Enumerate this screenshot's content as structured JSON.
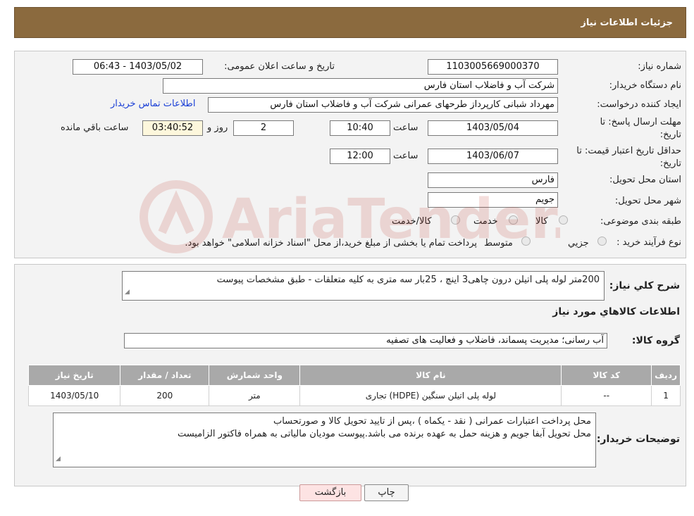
{
  "header": {
    "title": "جزئیات اطلاعات نیاز"
  },
  "fields": {
    "need_number_label": "شماره نیاز:",
    "need_number": "1103005669000370",
    "announce_label": "تاریخ و ساعت اعلان عمومی:",
    "announce_value": "1403/05/02 - 06:43",
    "buyer_org_label": "نام دستگاه خریدار:",
    "buyer_org": "شرکت آب و فاضلاب استان فارس",
    "creator_label": "ایجاد کننده درخواست:",
    "creator": "مهرداد شبانی کارپرداز طرحهای عمرانی  شرکت آب و فاضلاب استان فارس",
    "contact_link": "اطلاعات تماس خریدار",
    "deadline_label_1": "مهلت ارسال پاسخ: تا",
    "deadline_label_2": "تاریخ:",
    "deadline_date": "1403/05/04",
    "time_label": "ساعت",
    "deadline_time": "10:40",
    "days_value": "2",
    "days_label": "روز و",
    "remaining_time": "03:40:52",
    "remaining_label": "ساعت باقي مانده",
    "validity_label_1": "حداقل تاریخ اعتبار قیمت: تا",
    "validity_label_2": "تاریخ:",
    "validity_date": "1403/06/07",
    "validity_time_label": "ساعت",
    "validity_time": "12:00",
    "province_label": "استان محل تحویل:",
    "province": "فارس",
    "city_label": "شهر محل تحویل:",
    "city": "جویم",
    "category_label": "طبقه بندی موضوعی:",
    "category_options": [
      "کالا",
      "خدمت",
      "کالا/خدمت"
    ],
    "process_label": "نوع فرآیند خرید :",
    "process_options": [
      "جزیي",
      "متوسط"
    ],
    "process_note": "پرداخت تمام یا بخشی از مبلغ خرید،از محل \"اسناد خزانه اسلامی\" خواهد بود."
  },
  "description": {
    "label": "شرح كلي نياز:",
    "value": "200متر لوله پلی اتیلن درون چاهی3 اینچ ، 25بار سه متری به کلیه متعلقات - طبق مشخصات پیوست"
  },
  "goods_section_title": "اطلاعات كالاهاي مورد نياز",
  "goods_group": {
    "label": "گروه كالا:",
    "value": "آب رسانی؛ مدیریت پسماند، فاضلاب و فعالیت های تصفیه"
  },
  "table": {
    "headers": [
      "ردیف",
      "کد کالا",
      "نام کالا",
      "واحد شمارش",
      "تعداد / مقدار",
      "تاریخ نیاز"
    ],
    "rows": [
      [
        "1",
        "--",
        "لوله پلی اتیلن سنگین (HDPE) تجاری",
        "متر",
        "200",
        "1403/05/10"
      ]
    ]
  },
  "buyer_notes": {
    "label": "توضیحات خریدار:",
    "line1": "محل پرداخت اعتبارات عمرانی ( نقد - یکماه )    ،پس از تایید تحویل کالا و صورتحساب",
    "line2": "محل تحویل  آبفا جویم  و هزینه حمل به عهده برنده می باشد.پیوست مودیان مالیاتی به همراه فاکتور الزامیست"
  },
  "buttons": {
    "print": "چاپ",
    "back": "بازگشت"
  },
  "watermark_text": "AriaTender.neT",
  "colors": {
    "header": "#8b6a3e",
    "link": "#1a3fd6",
    "watermark": "#c0392b"
  }
}
